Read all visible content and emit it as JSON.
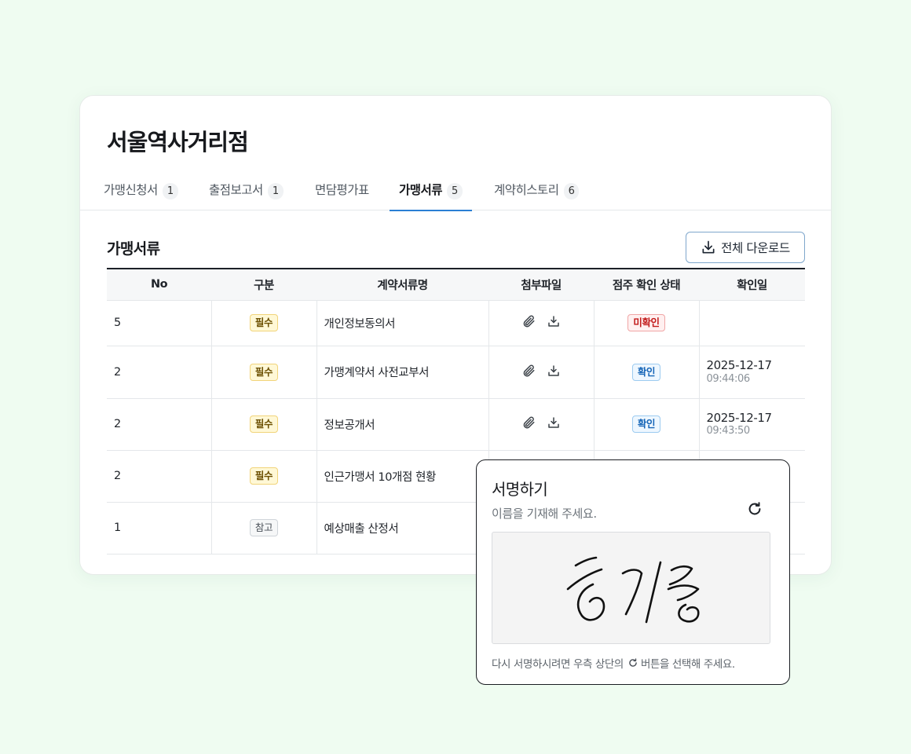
{
  "store": {
    "title": "서울역사거리점"
  },
  "tabs": [
    {
      "label": "가맹신청서",
      "count": "1"
    },
    {
      "label": "출점보고서",
      "count": "1"
    },
    {
      "label": "면담평가표",
      "count": ""
    },
    {
      "label": "가맹서류",
      "count": "5"
    },
    {
      "label": "계약히스토리",
      "count": "6"
    }
  ],
  "active_tab": "가맹서류",
  "section": {
    "title": "가맹서류",
    "download_all": "전체 다운로드"
  },
  "table": {
    "headers": [
      "No",
      "구분",
      "계약서류명",
      "첨부파일",
      "점주 확인 상태",
      "확인일"
    ],
    "rows": [
      {
        "no": "5",
        "type": "필수",
        "name": "개인정보동의서",
        "status": "미확인",
        "date": "",
        "time": ""
      },
      {
        "no": "2",
        "type": "필수",
        "name": "가맹계약서 사전교부서",
        "status": "확인",
        "date": "2025-12-17",
        "time": "09:44:06"
      },
      {
        "no": "2",
        "type": "필수",
        "name": "정보공개서",
        "status": "확인",
        "date": "2025-12-17",
        "time": "09:43:50"
      },
      {
        "no": "2",
        "type": "필수",
        "name": "인근가맹서 10개점 현황",
        "status": "",
        "date": "",
        "time": ""
      },
      {
        "no": "1",
        "type": "참고",
        "name": "예상매출 산정서",
        "status": "",
        "date": "",
        "time": ""
      }
    ]
  },
  "signature": {
    "title": "서명하기",
    "subtitle": "이름을 기재해 주세요.",
    "help_before": "다시 서명하시려면 우측 상단의",
    "help_after": "버튼을 선택해 주세요."
  },
  "colors": {
    "background": "#effcf1",
    "tab_underline": "#2a7fd4",
    "required_badge": "#fff8d6",
    "unconfirmed": "#c21b1b",
    "confirmed": "#1766b8"
  }
}
